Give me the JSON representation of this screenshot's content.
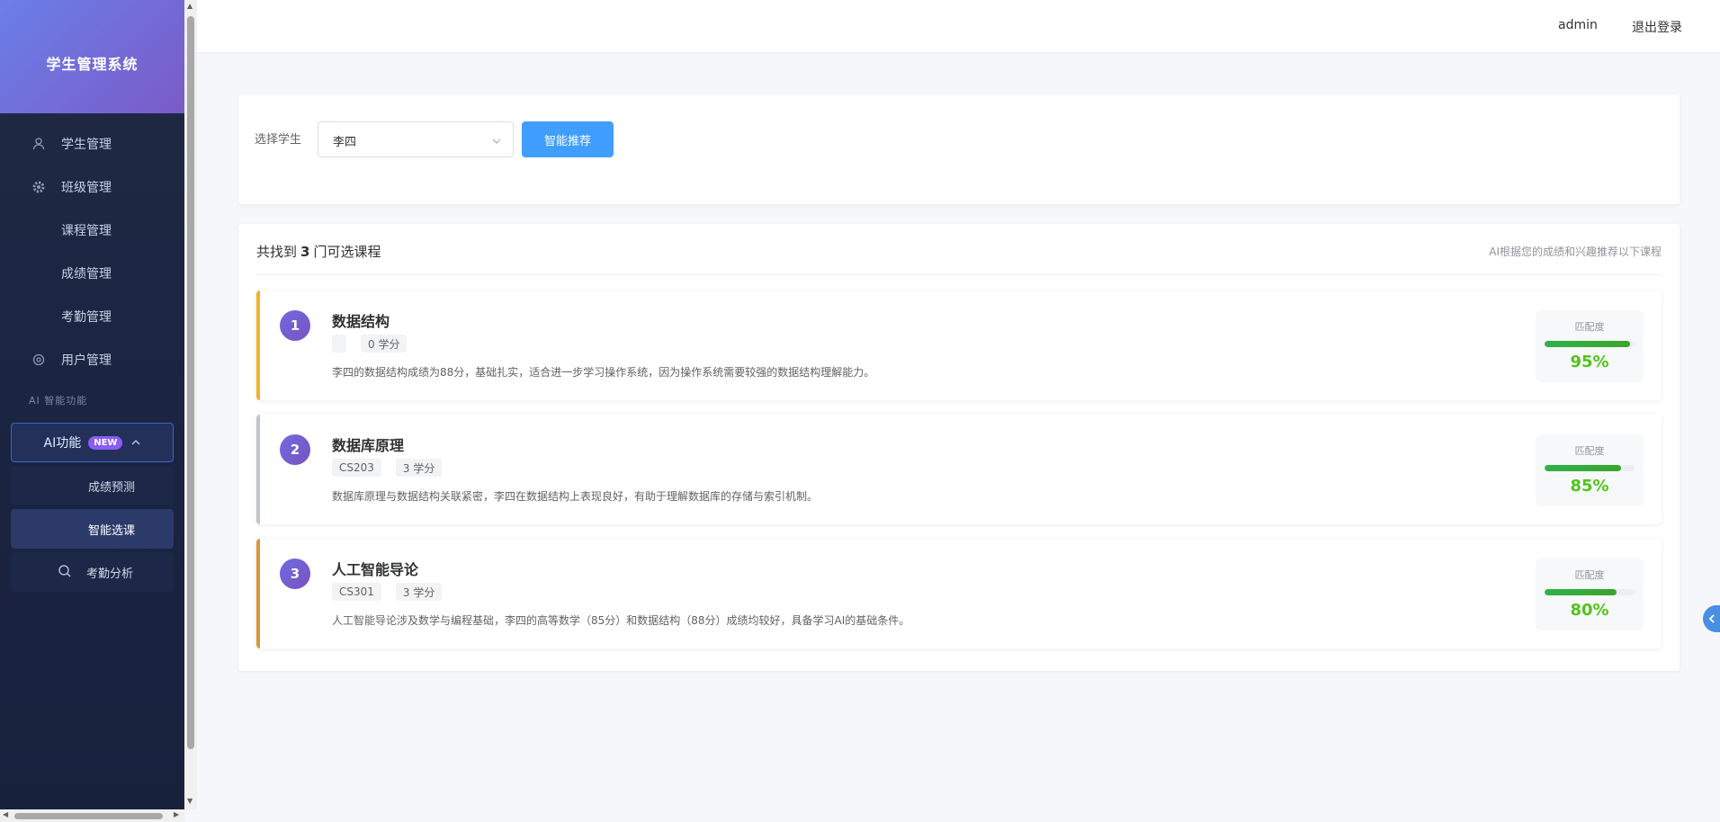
{
  "app": {
    "title": "学生管理系统"
  },
  "sidebar": {
    "items": [
      {
        "label": "学生管理",
        "icon": "user-icon"
      },
      {
        "label": "班级管理",
        "icon": "gear-icon"
      },
      {
        "label": "课程管理",
        "icon": ""
      },
      {
        "label": "成绩管理",
        "icon": ""
      },
      {
        "label": "考勤管理",
        "icon": ""
      },
      {
        "label": "用户管理",
        "icon": "settings-icon"
      }
    ],
    "section_label": "AI 智能功能",
    "ai_group": {
      "label": "AI功能",
      "badge": "NEW"
    },
    "ai_sub_items": [
      {
        "label": "成绩预测"
      },
      {
        "label": "智能选课"
      },
      {
        "label": "考勤分析",
        "icon": "search-icon"
      }
    ]
  },
  "header": {
    "user": "admin",
    "logout": "退出登录"
  },
  "filter": {
    "label": "选择学生",
    "selected": "李四",
    "button": "智能推荐"
  },
  "results": {
    "prefix": "共找到",
    "count": "3",
    "suffix": "门可选课程",
    "hint": "AI根据您的成绩和兴趣推荐以下课程",
    "match_label": "匹配度",
    "courses": [
      {
        "rank": "1",
        "name": "数据结构",
        "code": "",
        "credits": "0 学分",
        "desc": "李四的数据结构成绩为88分，基础扎实，适合进一步学习操作系统，因为操作系统需要较强的数据结构理解能力。",
        "match": 95,
        "match_text": "95%"
      },
      {
        "rank": "2",
        "name": "数据库原理",
        "code": "CS203",
        "credits": "3 学分",
        "desc": "数据库原理与数据结构关联紧密，李四在数据结构上表现良好，有助于理解数据库的存储与索引机制。",
        "match": 85,
        "match_text": "85%"
      },
      {
        "rank": "3",
        "name": "人工智能导论",
        "code": "CS301",
        "credits": "3 学分",
        "desc": "人工智能导论涉及数学与编程基础，李四的高等数学（85分）和数据结构（88分）成绩均较好，具备学习AI的基础条件。",
        "match": 80,
        "match_text": "80%"
      }
    ]
  }
}
